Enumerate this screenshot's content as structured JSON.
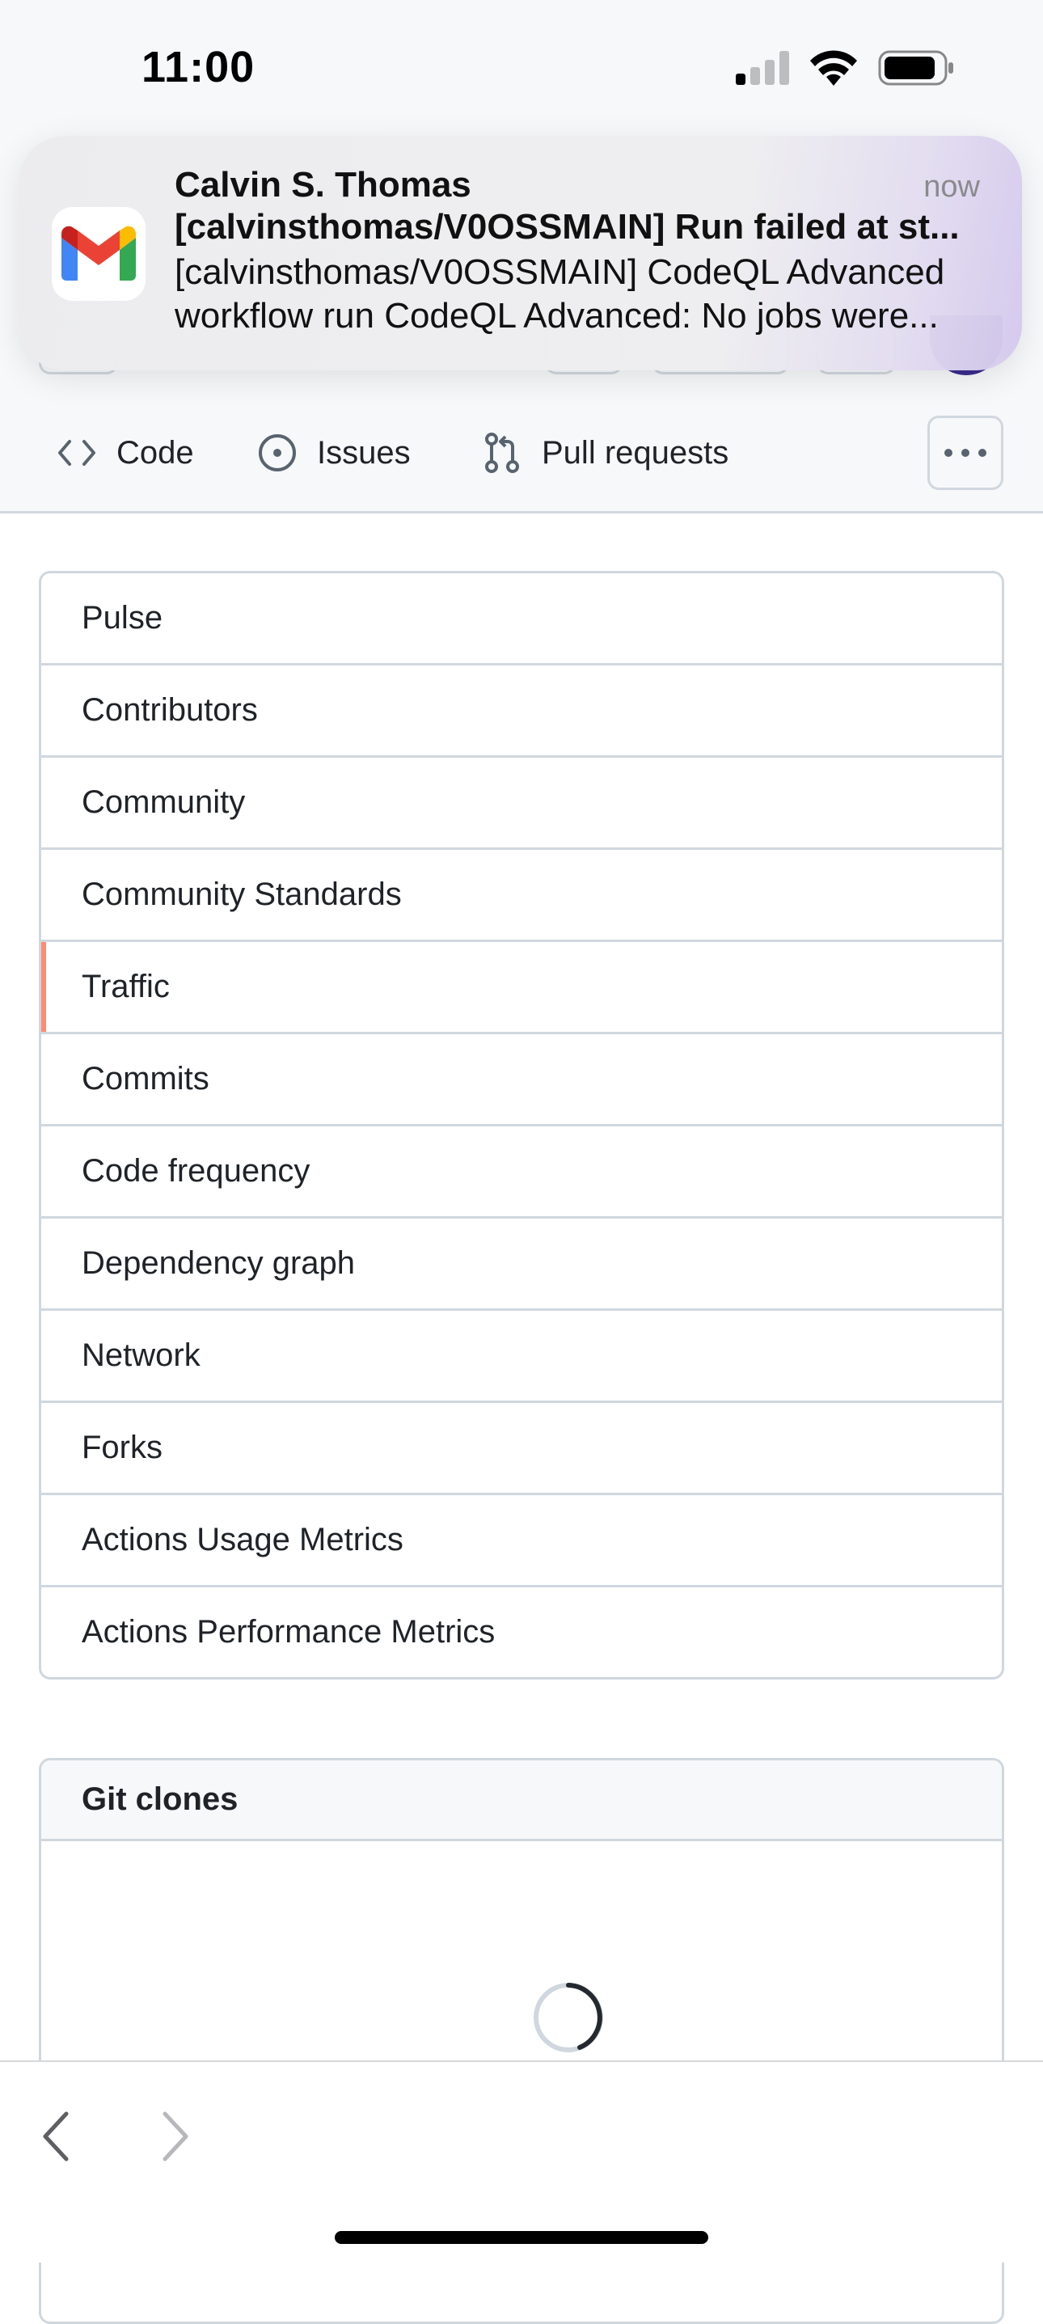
{
  "status_bar": {
    "time": "11:00",
    "icons": [
      "cellular-signal-icon",
      "wifi-icon",
      "battery-icon"
    ]
  },
  "notification": {
    "app_icon": "gmail-icon",
    "sender": "Calvin S. Thomas",
    "time": "now",
    "subject": "[calvinsthomas/V0OSSMAIN] Run failed at st...",
    "body_line1": "[calvinsthomas/V0OSSMAIN] CodeQL Advanced",
    "body_line2": "workflow run CodeQL Advanced: No jobs were..."
  },
  "repo_nav": {
    "tabs": [
      {
        "label": "Code",
        "icon": "code-icon"
      },
      {
        "label": "Issues",
        "icon": "issue-opened-icon"
      },
      {
        "label": "Pull requests",
        "icon": "git-pull-request-icon"
      }
    ],
    "more_icon": "kebab-horizontal-icon"
  },
  "insights_menu": {
    "selected": "Traffic",
    "items": [
      "Pulse",
      "Contributors",
      "Community",
      "Community Standards",
      "Traffic",
      "Commits",
      "Code frequency",
      "Dependency graph",
      "Network",
      "Forks",
      "Actions Usage Metrics",
      "Actions Performance Metrics"
    ]
  },
  "git_clones": {
    "title": "Git clones",
    "state_icon": "loading-spinner-icon"
  },
  "browser_toolbar": {
    "back_icon": "chevron-left-icon",
    "forward_icon": "chevron-right-icon"
  },
  "colors": {
    "selected_accent": "#fd8c73",
    "border": "#d0d7de",
    "header_bg": "#f6f8fa",
    "text": "#1f2328"
  }
}
